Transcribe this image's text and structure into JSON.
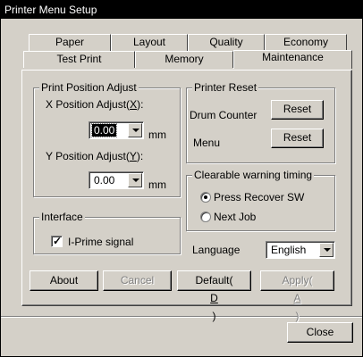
{
  "window": {
    "title": "Printer Menu Setup"
  },
  "tabs_back": [
    "Paper",
    "Layout",
    "Quality",
    "Economy"
  ],
  "tabs_front": [
    "Test Print",
    "Memory",
    "Maintenance"
  ],
  "print_position": {
    "group_label": "Print Position Adjust",
    "x_label": "X Position Adjust(",
    "x_key": "X",
    "x_label_end": "):",
    "x_value": "0.00",
    "x_unit": "mm",
    "y_label": "Y Position Adjust(",
    "y_key": "Y",
    "y_label_end": "):",
    "y_value": "0.00",
    "y_unit": "mm"
  },
  "printer_reset": {
    "group_label": "Printer Reset",
    "drum_label": "Drum Counter",
    "drum_button": "Reset",
    "menu_label": "Menu",
    "menu_button": "Reset"
  },
  "warning_timing": {
    "group_label": "Clearable warning timing",
    "option1": "Press Recover SW",
    "option2": "Next Job",
    "selected": "Press Recover SW"
  },
  "interface": {
    "group_label": "Interface",
    "checkbox_label": "I-Prime signal",
    "checked": true
  },
  "language": {
    "label": "Language",
    "value": "English"
  },
  "buttons": {
    "about": "About",
    "cancel": "Cancel",
    "default_prefix": "Default(",
    "default_key": "D",
    "default_suffix": ")",
    "apply_prefix": "Apply(",
    "apply_key": "A",
    "apply_suffix": ")",
    "close": "Close"
  },
  "colors": {
    "face": "#d4d0c8",
    "titlebar": "#000000",
    "disabled_text": "#808080"
  }
}
